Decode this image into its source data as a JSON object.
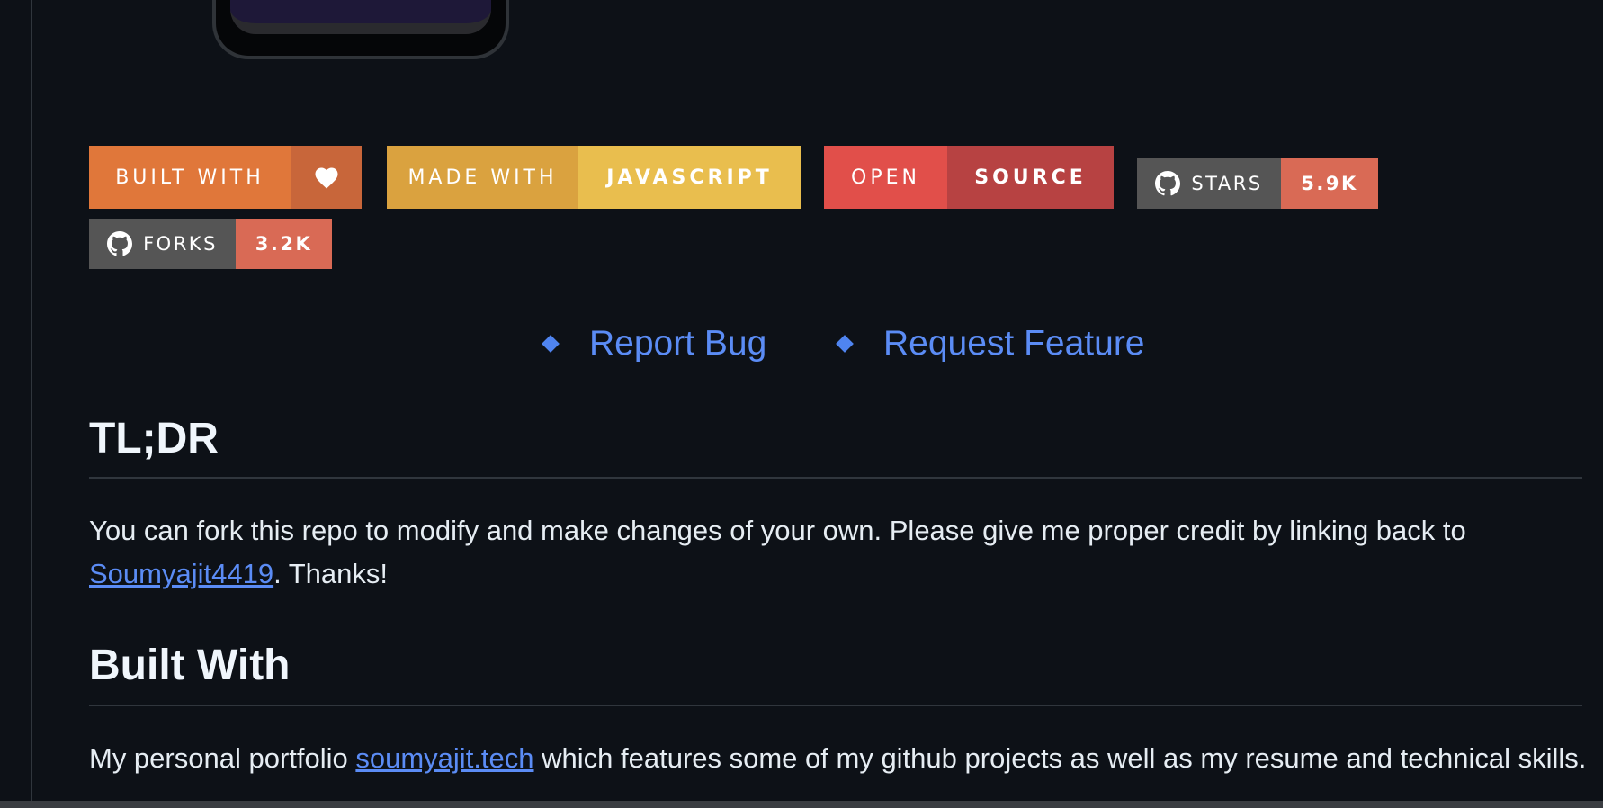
{
  "badges": {
    "built_with": {
      "left": "BUILT WITH",
      "right_icon": "heart-icon",
      "left_color": "#e0773a",
      "right_color": "#c8663a"
    },
    "made_with": {
      "left": "MADE WITH",
      "right": "JAVASCRIPT",
      "left_color": "#daa23f",
      "right_color": "#e9be4e"
    },
    "open_source": {
      "left": "OPEN",
      "right": "SOURCE",
      "left_color": "#e14f4a",
      "right_color": "#b74242"
    },
    "stars": {
      "icon": "github-icon",
      "left": "STARS",
      "right": "5.9K",
      "left_color": "#555555",
      "right_color": "#d96a55"
    },
    "forks": {
      "icon": "github-icon",
      "left": "FORKS",
      "right": "3.2K",
      "left_color": "#555555",
      "right_color": "#d96a55"
    }
  },
  "links": {
    "report_bug": "Report Bug",
    "request_feature": "Request Feature"
  },
  "tldr": {
    "heading": "TL;DR",
    "text_before": "You can fork this repo to modify and make changes of your own. Please give me proper credit by linking back to ",
    "link": "Soumyajit4419",
    "text_after": ". Thanks!"
  },
  "built_with": {
    "heading": "Built With",
    "text_before": "My personal portfolio ",
    "link": "soumyajit.tech",
    "text_after": " which features some of my github projects as well as my resume and technical skills."
  },
  "colors": {
    "background": "#0d1117",
    "link": "#5b8cf5"
  }
}
